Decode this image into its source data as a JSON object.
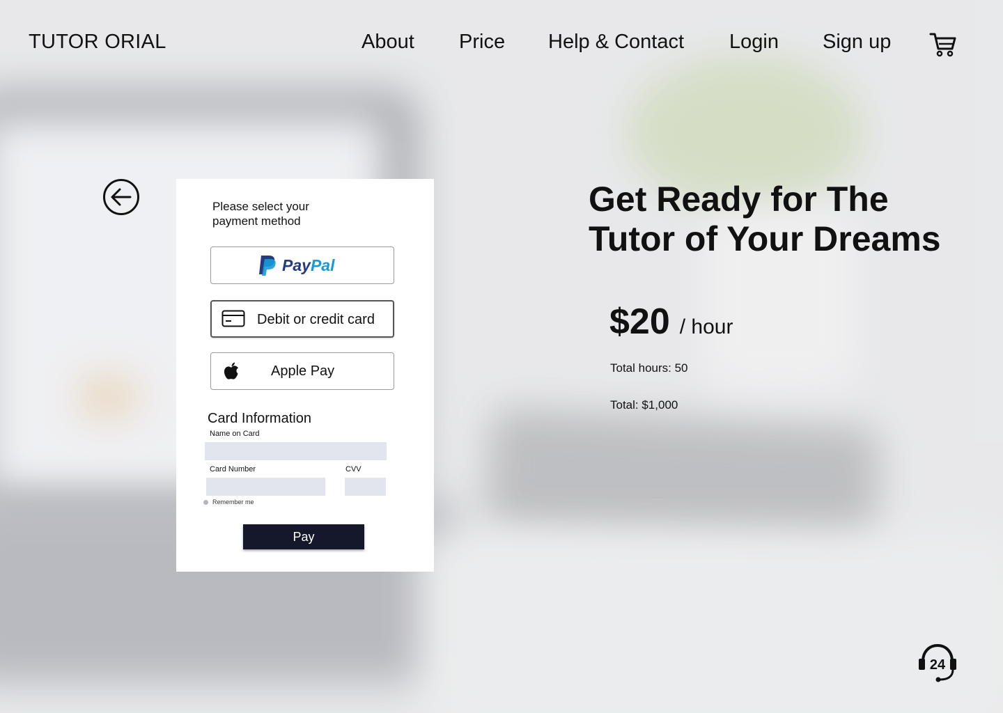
{
  "header": {
    "logo": "TUTOR ORIAL",
    "nav": {
      "about": "About",
      "price": "Price",
      "help": "Help & Contact",
      "login": "Login",
      "signup": "Sign up"
    },
    "cart_icon": "shopping-cart-icon"
  },
  "payment": {
    "title": "Please select your payment method",
    "methods": {
      "paypal": {
        "icon": "paypal-logo",
        "word_pay": "Pay",
        "word_pal": "Pal"
      },
      "card": {
        "icon": "credit-card-icon",
        "label": "Debit or credit card"
      },
      "apple": {
        "icon": "apple-logo-icon",
        "label": "Apple Pay"
      }
    },
    "card_info": {
      "title": "Card Information",
      "name_label": "Name on Card",
      "name_value": "",
      "number_label": "Card Number",
      "number_value": "",
      "cvv_label": "CVV",
      "cvv_value": "",
      "remember_label": "Remember me"
    },
    "pay_button": "Pay"
  },
  "summary": {
    "headline": "Get Ready for The Tutor of Your Dreams",
    "price_amount": "$20",
    "price_unit": "/ hour",
    "total_hours": "Total hours: 50",
    "total": "Total: $1,000"
  },
  "support_icon": "support-24-icon",
  "back_icon": "back-arrow-icon",
  "colors": {
    "pay_button": "#14182a",
    "input_bg": "#e3e5ee",
    "paypal_dark": "#253b80",
    "paypal_light": "#179bd7"
  }
}
